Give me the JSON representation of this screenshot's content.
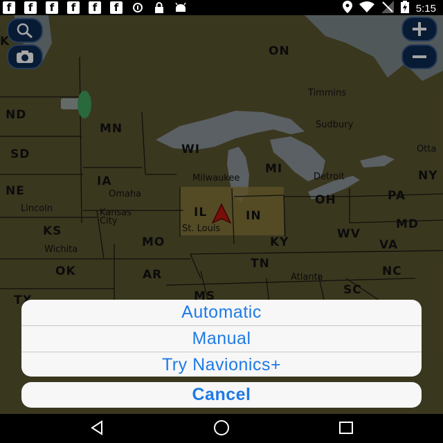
{
  "status_bar": {
    "time": "5:15",
    "fb_glyph": "f",
    "icons": [
      "facebook-icon",
      "facebook-icon",
      "facebook-icon",
      "facebook-icon",
      "facebook-icon",
      "facebook-icon",
      "data-saver-icon",
      "lock-icon",
      "android-debug-icon",
      "location-icon",
      "wifi-icon",
      "no-signal-icon",
      "battery-charging-icon"
    ]
  },
  "map": {
    "states": [
      "ON",
      "ND",
      "MN",
      "SD",
      "WI",
      "MI",
      "NE",
      "IA",
      "IL",
      "IN",
      "OH",
      "PA",
      "NY",
      "KS",
      "MO",
      "KY",
      "WV",
      "VA",
      "MD",
      "OK",
      "AR",
      "TN",
      "NC",
      "SC",
      "MS",
      "TX"
    ],
    "cities": [
      "Timmins",
      "Sudbury",
      "Otta",
      "Milwaukee",
      "Detroit",
      "Omaha",
      "Lincoln",
      "Kansas City",
      "St. Louis",
      "Wichita",
      "Atlanta"
    ],
    "left_edge_labels": [
      "K",
      "ND"
    ],
    "colors": {
      "land": "#5a5531",
      "water": "#808b8f",
      "highlight": "#8a7a3c",
      "marker": "#b8170f"
    },
    "buttons": {
      "search": "search-icon",
      "camera": "camera-icon",
      "zoom_in": "plus-icon",
      "zoom_out": "minus-icon"
    }
  },
  "action_sheet": {
    "options": [
      "Automatic",
      "Manual",
      "Try Navionics+"
    ],
    "cancel_label": "Cancel",
    "accent_color": "#1e7ae6"
  },
  "nav_bar": {
    "icons": [
      "back-icon",
      "home-icon",
      "recents-icon"
    ]
  }
}
